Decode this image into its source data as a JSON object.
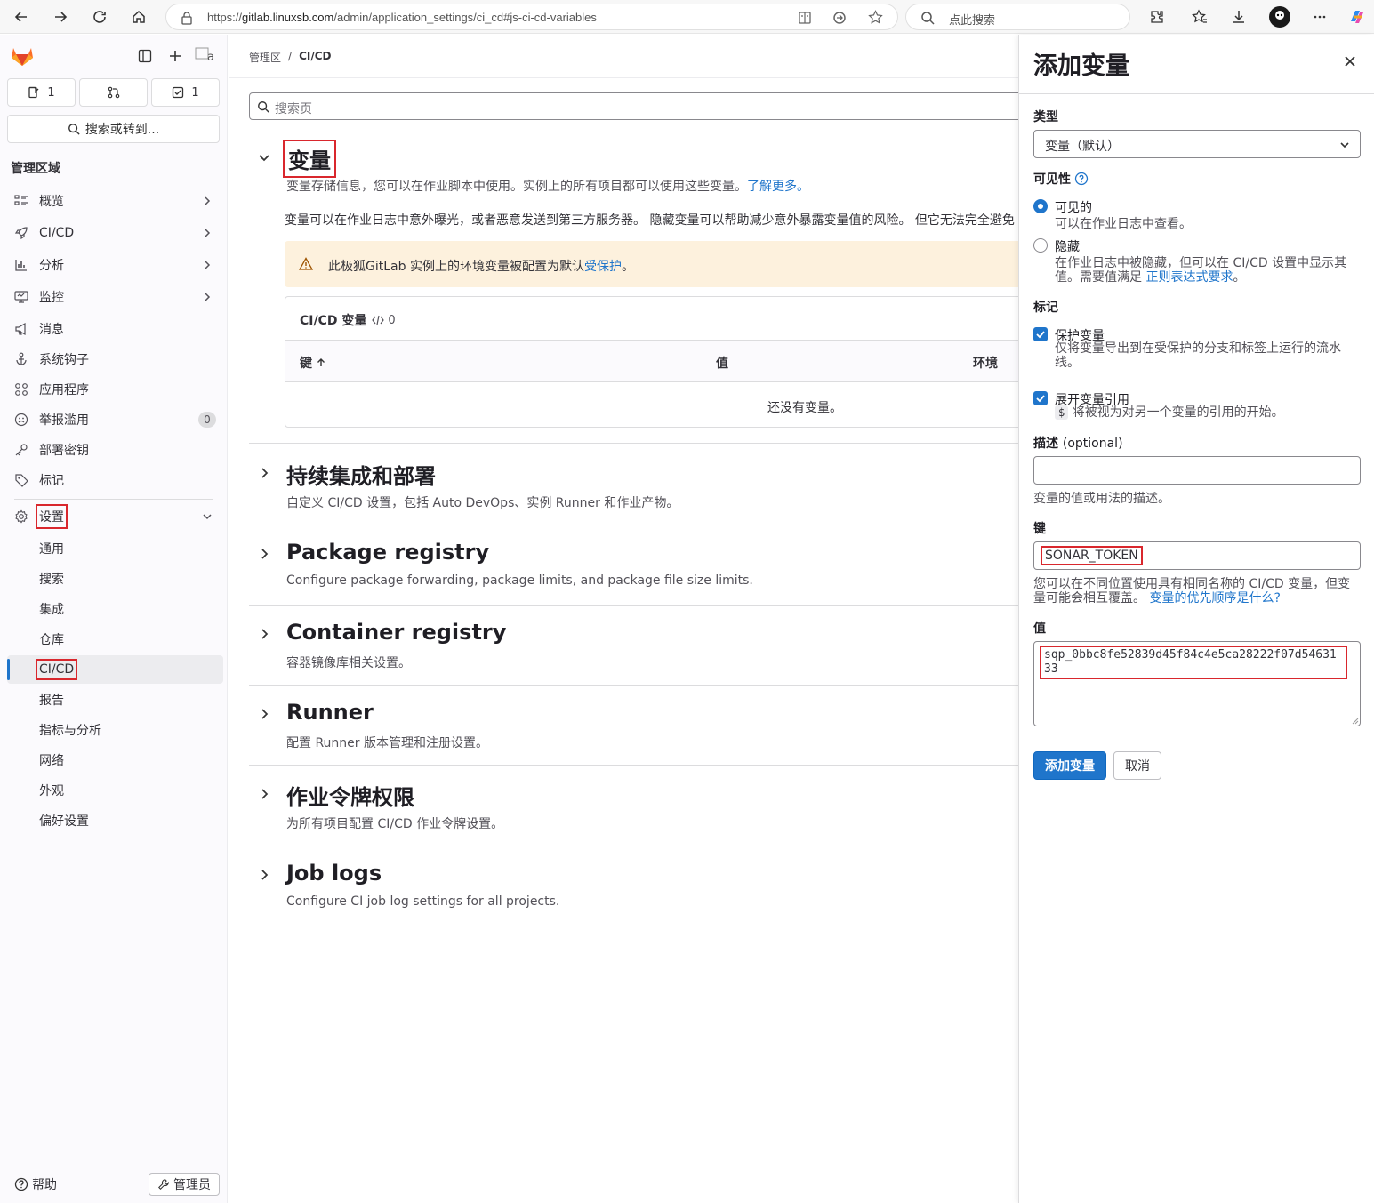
{
  "browser": {
    "url_prefix": "https://",
    "url_host": "gitlab.linuxsb.com",
    "url_path": "/admin/application_settings/ci_cd#js-ci-cd-variables",
    "search_placeholder": "点此搜索"
  },
  "sidebar": {
    "issues_count": "1",
    "todos_count": "1",
    "search_label": "搜索或转到...",
    "area_title": "管理区域",
    "items": [
      {
        "label": "概览",
        "icon": "overview-icon"
      },
      {
        "label": "CI/CD",
        "icon": "rocket-icon"
      },
      {
        "label": "分析",
        "icon": "chart-icon"
      },
      {
        "label": "监控",
        "icon": "monitor-icon"
      },
      {
        "label": "消息",
        "icon": "bullhorn-icon"
      },
      {
        "label": "系统钩子",
        "icon": "hook-icon"
      },
      {
        "label": "应用程序",
        "icon": "applications-icon"
      },
      {
        "label": "举报滥用",
        "icon": "abuse-icon",
        "badge": "0"
      },
      {
        "label": "部署密钥",
        "icon": "key-icon"
      },
      {
        "label": "标记",
        "icon": "label-icon"
      },
      {
        "label": "设置",
        "icon": "settings-icon"
      }
    ],
    "settings_sub": [
      "通用",
      "搜索",
      "集成",
      "仓库",
      "CI/CD",
      "报告",
      "指标与分析",
      "网络",
      "外观",
      "偏好设置"
    ],
    "help_label": "帮助",
    "admin_label": "管理员"
  },
  "main": {
    "breadcrumb": [
      "管理区",
      "CI/CD"
    ],
    "search_placeholder": "搜索页",
    "variables": {
      "title": "变量",
      "desc": "变量存储信息，您可以在作业脚本中使用。实例上的所有项目都可以使用这些变量。",
      "learn_more": "了解更多。",
      "warning_line": "变量可以在作业日志中意外曝光，或者恶意发送到第三方服务器。 隐藏变量可以帮助减少意外暴露变量值的风险。 但它无法完全避免",
      "alert_text": "此极狐GitLab 实例上的环境变量被配置为默认",
      "alert_link": "受保护",
      "alert_end": "。",
      "card_title": "CI/CD 变量",
      "card_count": "0",
      "col_key": "键",
      "col_value": "值",
      "col_env": "环境",
      "empty": "还没有变量。"
    },
    "sections": [
      {
        "title": "持续集成和部署",
        "desc": "自定义 CI/CD 设置，包括 Auto DevOps、实例 Runner 和作业产物。"
      },
      {
        "title": "Package registry",
        "desc": "Configure package forwarding, package limits, and package file size limits."
      },
      {
        "title": "Container registry",
        "desc": "容器镜像库相关设置。"
      },
      {
        "title": "Runner",
        "desc": "配置 Runner 版本管理和注册设置。"
      },
      {
        "title": "作业令牌权限",
        "desc": "为所有项目配置 CI/CD 作业令牌设置。"
      },
      {
        "title": "Job logs",
        "desc": "Configure CI job log settings for all projects."
      }
    ]
  },
  "drawer": {
    "title": "添加变量",
    "type_label": "类型",
    "type_value": "变量（默认）",
    "visibility_label": "可见性",
    "visible_title": "可见的",
    "visible_desc": "可以在作业日志中查看。",
    "hidden_title": "隐藏",
    "hidden_desc": "在作业日志中被隐藏，但可以在 CI/CD 设置中显示其值。需要值满足",
    "hidden_link": "正则表达式要求",
    "hidden_end": "。",
    "flags_label": "标记",
    "protect_title": "保护变量",
    "protect_desc": "仅将变量导出到在受保护的分支和标签上运行的流水线。",
    "expand_title": "展开变量引用",
    "expand_chip": "$",
    "expand_desc": "将被视为对另一个变量的引用的开始。",
    "desc_label": "描述",
    "desc_optional": "(optional)",
    "desc_value": "",
    "desc_help": "变量的值或用法的描述。",
    "key_label": "键",
    "key_value": "SONAR_TOKEN",
    "key_help": "您可以在不同位置使用具有相同名称的 CI/CD 变量，但变量可能会相互覆盖。",
    "key_help_link": "变量的优先顺序是什么?",
    "value_label": "值",
    "value_value": "sqp_0bbc8fe52839d45f84c4e5ca28222f07d5463133",
    "add_button": "添加变量",
    "cancel_button": "取消"
  },
  "colors": {
    "accent": "#1f75cb",
    "highlight": "#d9272d",
    "warning_bg": "#fdf1dd"
  }
}
